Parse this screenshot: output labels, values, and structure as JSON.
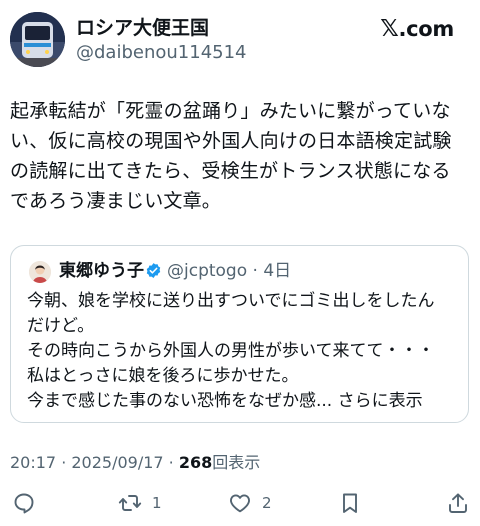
{
  "author": {
    "name": "ロシア大便王国",
    "handle": "@daibenou114514"
  },
  "brand": {
    "x": "𝕏",
    "text": ".com"
  },
  "tweet": {
    "lines": [
      "起承転結が「死霊の盆踊り」みたいに繋がっていな",
      "い、仮に高校の現国や外国人向けの日本語検定試験",
      "の読解に出てきたら、受検生がトランス状態になる",
      "であろう凄まじい文章。"
    ]
  },
  "quote": {
    "name": "東郷ゆう子",
    "handle": "@jcptogo · 4日",
    "lines": [
      "今朝、娘を学校に送り出すついでにゴミ出しをしたん",
      "だけど。",
      "その時向こうから外国人の男性が歩いて来てて・・・",
      "私はとっさに娘を後ろに歩かせた。"
    ],
    "last_line": "今まで感じた事のない恐怖をなぜか感...",
    "more_label": "さらに表示"
  },
  "meta": {
    "datetime": "20:17 · 2025/09/17 · ",
    "views_count": "268",
    "views_label": "回表示"
  },
  "actions": {
    "reply_icon": "comment-icon",
    "retweet_count": "1",
    "like_count": "2",
    "bookmark_icon": "bookmark-icon",
    "share_icon": "share-icon"
  },
  "colors": {
    "text": "#0f1419",
    "secondary": "#536471",
    "border": "#cfd9de",
    "verified": "#1d9bf0"
  }
}
